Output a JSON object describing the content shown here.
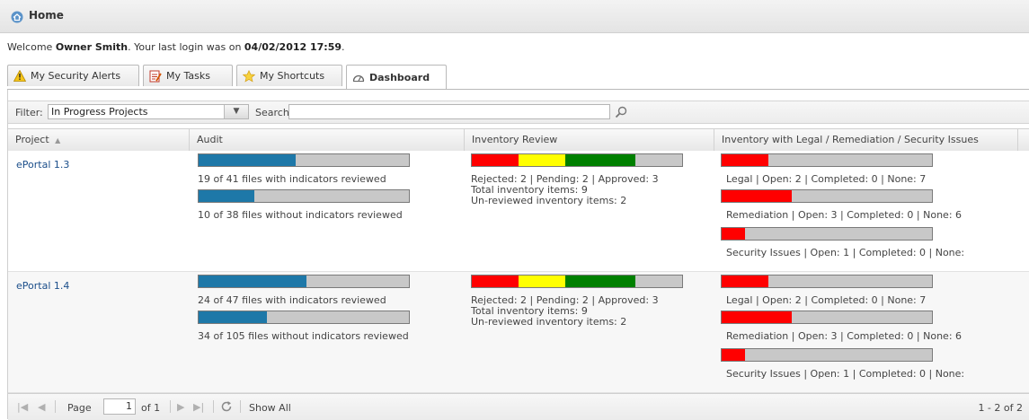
{
  "header": {
    "title": "Home",
    "icon": "home-icon"
  },
  "welcome": {
    "prefix": "Welcome ",
    "user": "Owner Smith",
    "middle": ". Your last login was on ",
    "last_login": "04/02/2012 17:59",
    "suffix": "."
  },
  "tabs": [
    {
      "label": "My Security Alerts",
      "icon": "warning-icon"
    },
    {
      "label": "My Tasks",
      "icon": "tasks-icon"
    },
    {
      "label": "My Shortcuts",
      "icon": "star-icon"
    },
    {
      "label": "Dashboard",
      "icon": "dashboard-icon",
      "active": true
    }
  ],
  "toolbar": {
    "filter_label": "Filter:",
    "filter_value": "In Progress Projects",
    "search_label": "Search:",
    "search_value": ""
  },
  "columns": {
    "project": "Project",
    "audit": "Audit",
    "inventory_review": "Inventory Review",
    "issues": "Inventory with Legal / Remediation / Security Issues"
  },
  "rows": [
    {
      "project": "ePortal 1.3",
      "audit_with": {
        "fraction": 0.463,
        "label": "19 of 41 files with indicators reviewed"
      },
      "audit_without": {
        "fraction": 0.263,
        "label": "10 of 38 files without indicators reviewed"
      },
      "review": {
        "rejected": 2,
        "pending": 2,
        "approved": 3,
        "unreviewed": 2,
        "summary": "Rejected: 2 | Pending: 2 | Approved: 3",
        "total": "Total inventory items: 9",
        "unreviewed_text": "Un-reviewed inventory items: 2"
      },
      "legal": {
        "fraction": 0.222,
        "label": "Legal | Open: 2 | Completed: 0 | None: 7"
      },
      "remediation": {
        "fraction": 0.333,
        "label": "Remediation | Open: 3 | Completed: 0 | None: 6"
      },
      "security": {
        "fraction": 0.111,
        "label": "Security Issues | Open: 1 | Completed: 0 | None:"
      }
    },
    {
      "project": "ePortal 1.4",
      "audit_with": {
        "fraction": 0.511,
        "label": "24 of 47 files with indicators reviewed"
      },
      "audit_without": {
        "fraction": 0.324,
        "label": "34 of 105 files without indicators reviewed"
      },
      "review": {
        "rejected": 2,
        "pending": 2,
        "approved": 3,
        "unreviewed": 2,
        "summary": "Rejected: 2 | Pending: 2 | Approved: 3",
        "total": "Total inventory items: 9",
        "unreviewed_text": "Un-reviewed inventory items: 2"
      },
      "legal": {
        "fraction": 0.222,
        "label": "Legal | Open: 2 | Completed: 0 | None: 7"
      },
      "remediation": {
        "fraction": 0.333,
        "label": "Remediation | Open: 3 | Completed: 0 | None: 6"
      },
      "security": {
        "fraction": 0.111,
        "label": "Security Issues | Open: 1 | Completed: 0 | None:"
      }
    }
  ],
  "pager": {
    "page_label": "Page",
    "page_value": "1",
    "of_label": "of 1",
    "show_all": "Show All",
    "count": "1 - 2 of 2"
  },
  "colors": {
    "audit_fill": "#1e78a8",
    "rejected": "#ff0000",
    "pending": "#ffff00",
    "approved": "#008000",
    "unreviewed": "#c8c8c8",
    "issue_fill": "#ff0000",
    "link": "#1b4e8a"
  }
}
